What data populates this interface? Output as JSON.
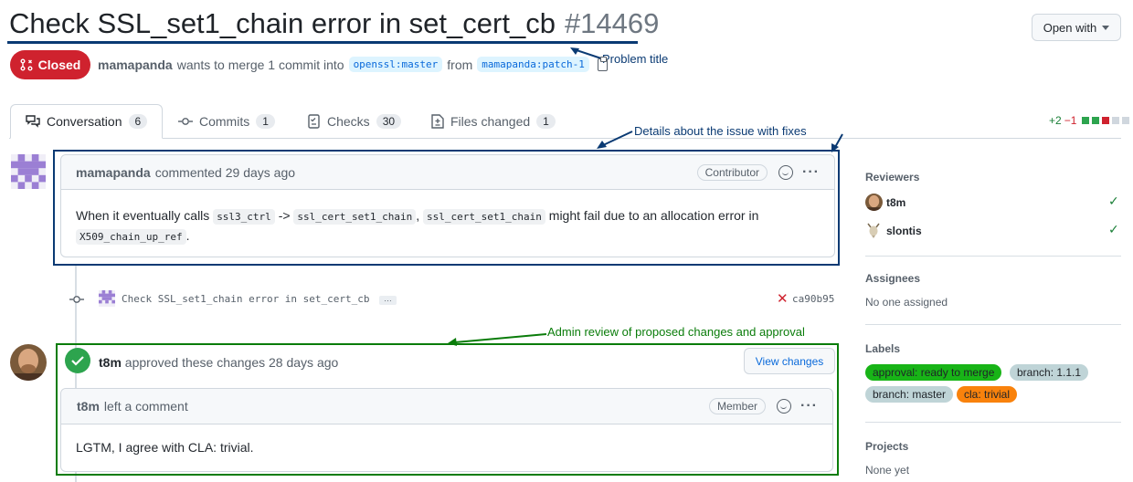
{
  "pr": {
    "title": "Check SSL_set1_chain error in set_cert_cb",
    "number": "#14469",
    "state": "Closed",
    "author": "mamapanda",
    "merge_text": "wants to merge 1 commit into",
    "base_branch": "openssl:master",
    "from_text": "from",
    "head_branch": "mamapanda:patch-1"
  },
  "header": {
    "open_with": "Open with"
  },
  "annotations": {
    "problem_title": "Problem title",
    "details": "Details about the issue with fixes",
    "admin_review": "Admin review of proposed changes and approval"
  },
  "tabs": [
    {
      "label": "Conversation",
      "count": "6"
    },
    {
      "label": "Commits",
      "count": "1"
    },
    {
      "label": "Checks",
      "count": "30"
    },
    {
      "label": "Files changed",
      "count": "1"
    }
  ],
  "diffstat": {
    "added": "+2",
    "removed": "−1"
  },
  "comment1": {
    "author": "mamapanda",
    "action": "commented 29 days ago",
    "role": "Contributor",
    "body": {
      "t1": "When it eventually calls",
      "c1": "ssl3_ctrl",
      "t2": "->",
      "c2": "ssl_cert_set1_chain",
      "t3": ",",
      "c3": "ssl_cert_set1_chain",
      "t4": "might fail due to an allocation error in",
      "c4": "X509_chain_up_ref",
      "t5": "."
    }
  },
  "commit": {
    "message": "Check SSL_set1_chain error in set_cert_cb",
    "ellipsis": "…",
    "sha": "ca90b95"
  },
  "review": {
    "author": "t8m",
    "action": "approved these changes 28 days ago",
    "view_changes": "View changes",
    "inner_author": "t8m",
    "inner_action": "left a comment",
    "role": "Member",
    "body": "LGTM, I agree with CLA: trivial."
  },
  "sidebar": {
    "reviewers_heading": "Reviewers",
    "reviewers": [
      "t8m",
      "slontis"
    ],
    "assignees_heading": "Assignees",
    "assignees_value": "No one assigned",
    "labels_heading": "Labels",
    "labels": [
      "approval: ready to merge",
      "branch: 1.1.1",
      "branch: master",
      "cla: trivial"
    ],
    "projects_heading": "Projects",
    "projects_value": "None yet"
  },
  "colors": {
    "annotation_blue": "#0a3a73",
    "annotation_green": "#0a7c0a",
    "closed_red": "#cf222e",
    "approved_green": "#2da44e"
  }
}
